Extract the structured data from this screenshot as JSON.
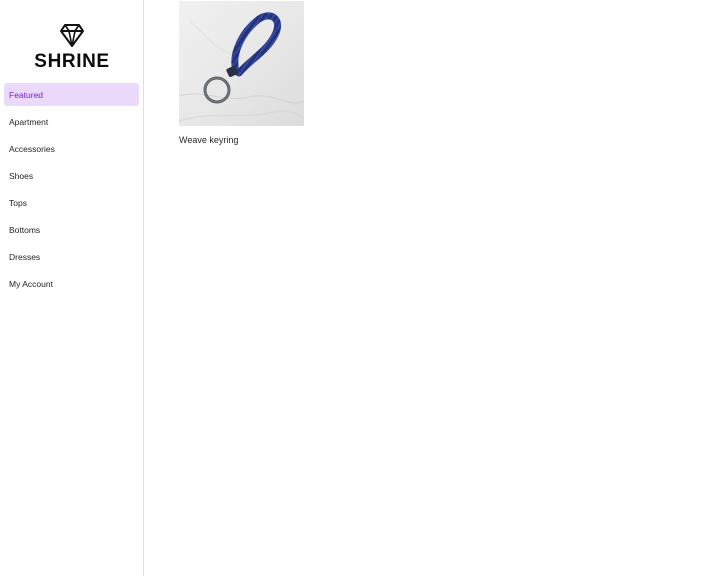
{
  "sidebar": {
    "brand": "SHRINE",
    "logo_icon": "diamond-icon",
    "items": [
      {
        "label": "Featured",
        "active": true
      },
      {
        "label": "Apartment",
        "active": false
      },
      {
        "label": "Accessories",
        "active": false
      },
      {
        "label": "Shoes",
        "active": false
      },
      {
        "label": "Tops",
        "active": false
      },
      {
        "label": "Bottoms",
        "active": false
      },
      {
        "label": "Dresses",
        "active": false
      },
      {
        "label": "My Account",
        "active": false
      }
    ]
  },
  "main": {
    "products": [
      {
        "name": "Weave keyring",
        "image": "weave-keyring-photo"
      }
    ]
  },
  "colors": {
    "accent": "#7b1fd1",
    "active_background": "#ead9fb",
    "divider": "#e0e0e0"
  }
}
